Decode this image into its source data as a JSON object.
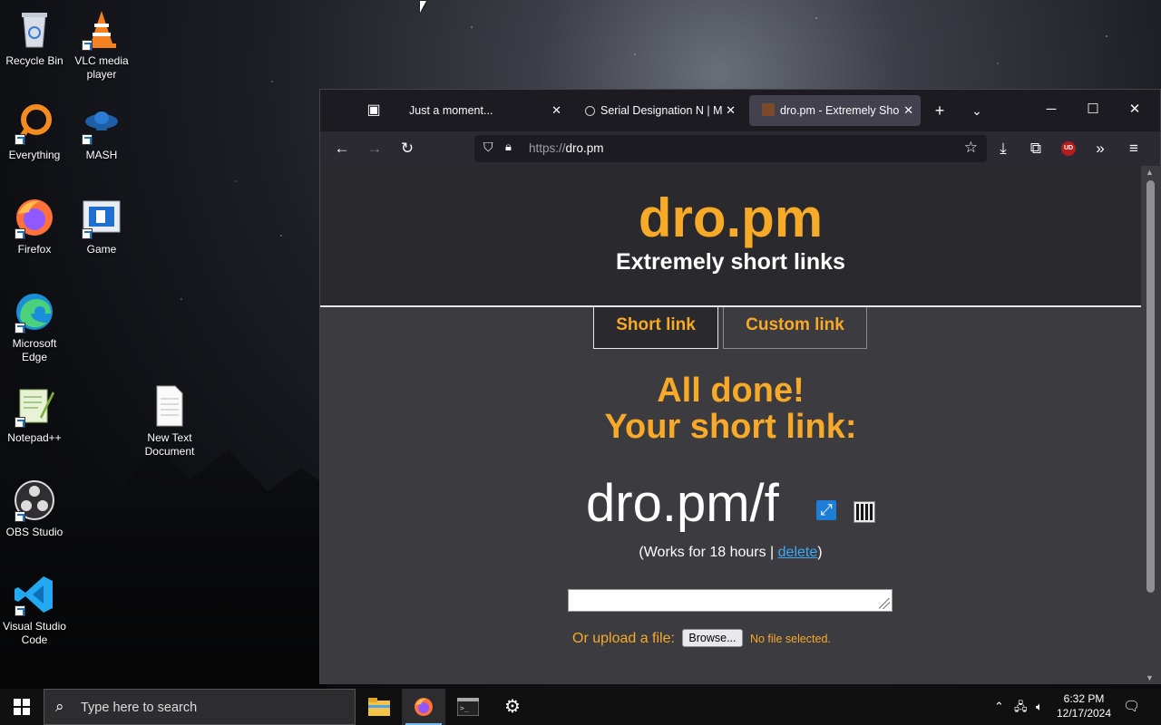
{
  "desktop": {
    "icons": [
      {
        "label": "Recycle Bin",
        "icon": "recycle-bin-icon"
      },
      {
        "label": "VLC media player",
        "icon": "vlc-icon"
      },
      {
        "label": "Everything",
        "icon": "everything-icon"
      },
      {
        "label": "MASH",
        "icon": "mash-icon"
      },
      {
        "label": "Firefox",
        "icon": "firefox-icon"
      },
      {
        "label": "Game",
        "icon": "game-icon"
      },
      {
        "label": "Microsoft Edge",
        "icon": "edge-icon"
      },
      {
        "label": "Notepad++",
        "icon": "notepadpp-icon"
      },
      {
        "label": "New Text Document",
        "icon": "text-document-icon"
      },
      {
        "label": "OBS Studio",
        "icon": "obs-icon"
      },
      {
        "label": "Visual Studio Code",
        "icon": "vscode-icon"
      }
    ]
  },
  "browser": {
    "tabs": [
      {
        "title": "Just a moment...",
        "active": false
      },
      {
        "title": "Serial Designation N | Mu",
        "active": false
      },
      {
        "title": "dro.pm - Extremely Short",
        "active": true
      }
    ],
    "url_prefix": "https://",
    "url_host": "dro.pm",
    "ublock_label": "UD"
  },
  "page": {
    "logo": "dro.pm",
    "tagline": "Extremely short links",
    "tab_short": "Short link",
    "tab_custom": "Custom link",
    "done_line1": "All done!",
    "done_line2": "Your short link:",
    "short_link": "dro.pm/f",
    "works_prefix": "(Works for 18 hours | ",
    "delete_link": "delete",
    "works_suffix": ")",
    "upload_label": "Or upload a file:",
    "browse_button": "Browse...",
    "no_file": "No file selected."
  },
  "taskbar": {
    "search_placeholder": "Type here to search",
    "time": "6:32 PM",
    "date": "12/17/2024"
  },
  "colors": {
    "accent_orange": "#f7a928",
    "page_bg": "#3b3b40",
    "header_bg": "#2a2a2e",
    "link_blue": "#3fa9f5"
  }
}
